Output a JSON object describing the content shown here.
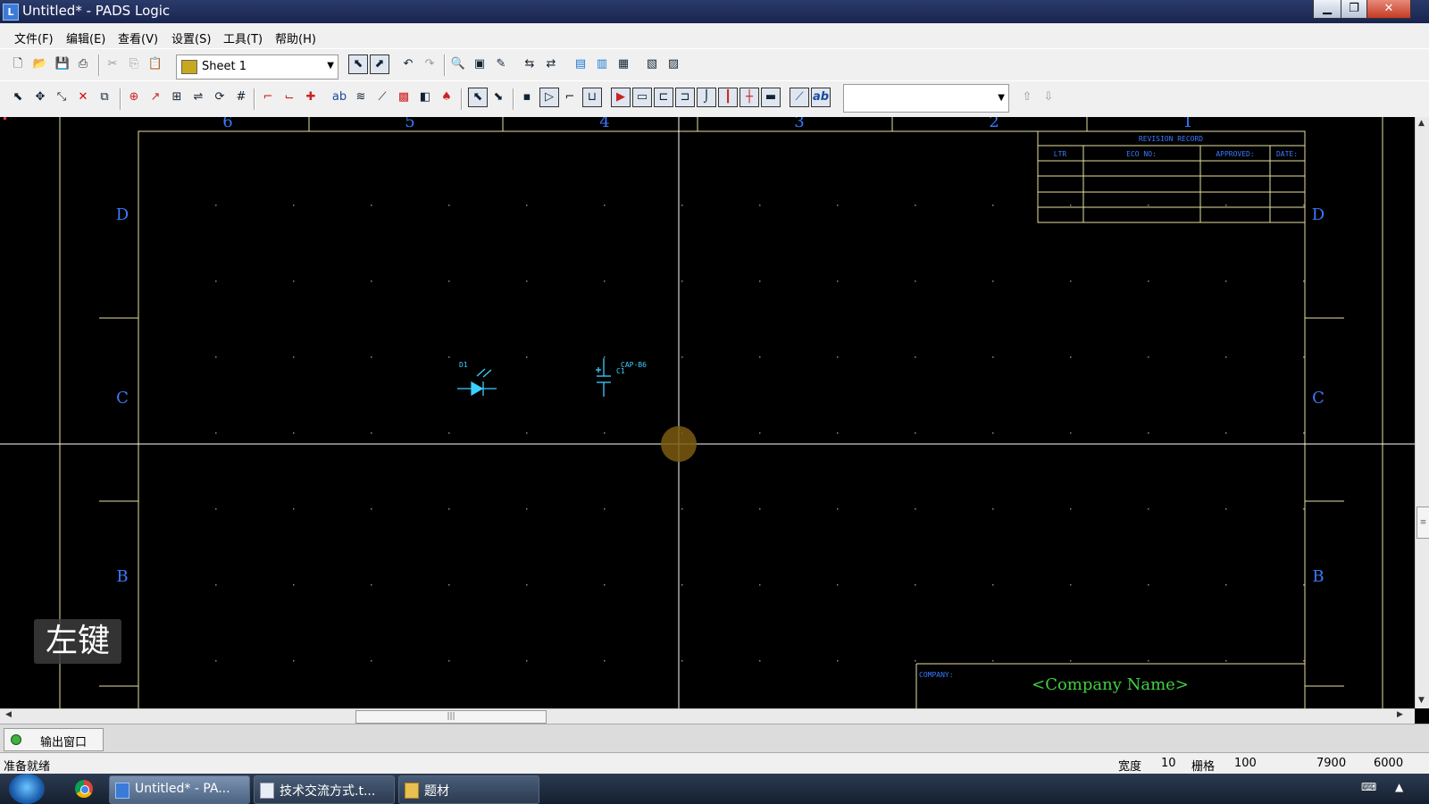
{
  "window": {
    "title": "Untitled* - PADS Logic",
    "app_icon": "pads-logic-icon",
    "controls": [
      "minimize-icon",
      "maximize-icon",
      "close-icon"
    ]
  },
  "menu": [
    "文件(F)",
    "编辑(E)",
    "查看(V)",
    "设置(S)",
    "工具(T)",
    "帮助(H)"
  ],
  "toolbar1": {
    "sheet_selector": "Sheet 1"
  },
  "toolbar2": {
    "combo_value": ""
  },
  "schematic": {
    "border_color": "#e8e0a0",
    "zone_label_color": "#3a7aff",
    "column_labels": [
      "6",
      "5",
      "4",
      "3",
      "2",
      "1"
    ],
    "row_labels": [
      "D",
      "C",
      "B"
    ],
    "revision_block": {
      "title": "REVISION RECORD",
      "headers": [
        "LTR",
        "ECO NO:",
        "APPROVED:",
        "DATE:"
      ]
    },
    "title_block": {
      "company_label": "COMPANY:",
      "company_name": "<Company Name>",
      "company_color": "#40d040"
    },
    "components": [
      {
        "ref": "D1",
        "type": "led"
      },
      {
        "ref": "C1",
        "value": "CAP-B6",
        "type": "capacitor"
      }
    ],
    "overlay_hint": "左键"
  },
  "output_window": {
    "tab_label": "输出窗口"
  },
  "statusbar": {
    "message": "准备就绪",
    "width_label": "宽度",
    "width_value": "10",
    "grid_label": "栅格",
    "grid_value": "100",
    "x": "7900",
    "y": "6000"
  },
  "taskbar": {
    "tasks": [
      {
        "label": "Untitled* - PA...",
        "icon": "pads-logic-icon",
        "active": true
      },
      {
        "label": "技术交流方式.t...",
        "icon": "notepad-icon",
        "active": false
      },
      {
        "label": "题材",
        "icon": "folder-icon",
        "active": false
      }
    ]
  }
}
